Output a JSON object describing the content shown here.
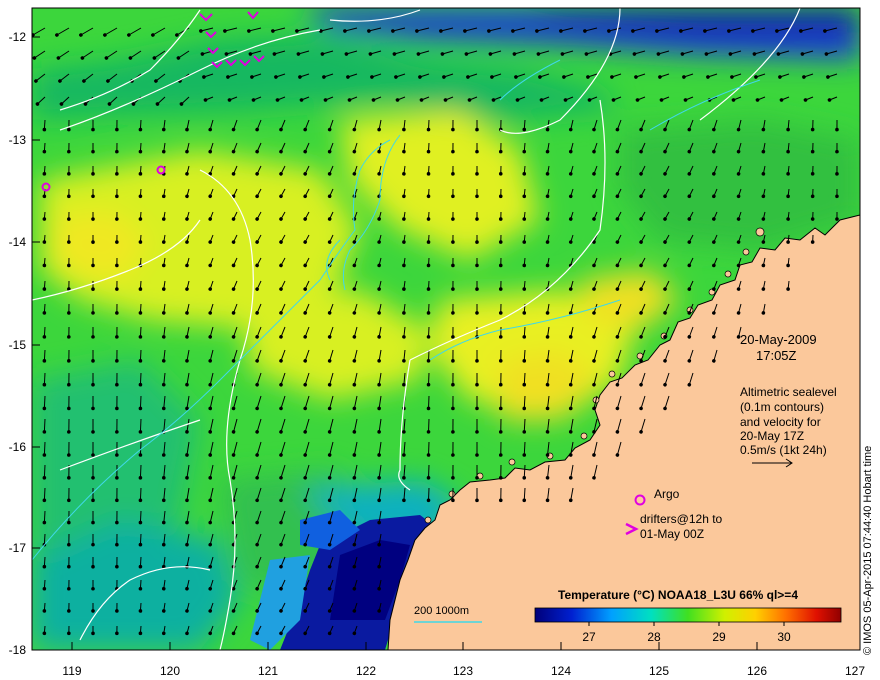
{
  "map": {
    "lon_ticks": [
      "119",
      "120",
      "121",
      "122",
      "123",
      "124",
      "125",
      "126",
      "127"
    ],
    "lat_ticks": [
      "-12",
      "-13",
      "-14",
      "-15",
      "-16",
      "-17",
      "-18"
    ],
    "land_color": "#fbc89b",
    "deep_water_color": "#000080"
  },
  "info": {
    "date": "20-May-2009",
    "time": "17:05Z",
    "description_lines": [
      "Altimetric sealevel",
      "(0.1m contours)",
      "and velocity for",
      "20-May 17Z",
      "0.5m/s (1kt 24h)"
    ]
  },
  "legend": {
    "argo_label": "Argo",
    "drifters_line1": "drifters@12h to",
    "drifters_line2": "01-May 00Z",
    "bathy_label": "200  1000m",
    "argo_color": "#e000e0"
  },
  "colorbar": {
    "title": "Temperature (°C) NOAA18_L3U 66% ql>=4",
    "ticks": [
      "27",
      "28",
      "29",
      "30"
    ]
  },
  "credit": "© IMOS 05-Apr-2015 07:44:40 Hobart time"
}
